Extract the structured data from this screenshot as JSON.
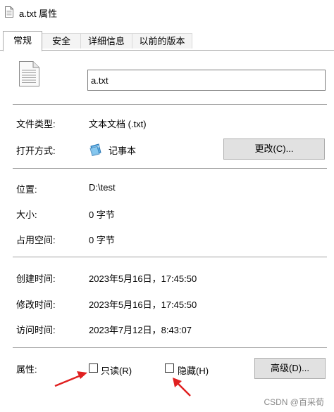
{
  "window": {
    "title": "a.txt 属性"
  },
  "tabs": [
    {
      "label": "常规",
      "active": true
    },
    {
      "label": "安全",
      "active": false
    },
    {
      "label": "详细信息",
      "active": false
    },
    {
      "label": "以前的版本",
      "active": false
    }
  ],
  "general": {
    "file_name": "a.txt",
    "file_type_label": "文件类型:",
    "file_type_value": "文本文档 (.txt)",
    "open_with_label": "打开方式:",
    "open_with_app": "记事本",
    "change_button": "更改(C)...",
    "location_label": "位置:",
    "location_value": "D:\\test",
    "size_label": "大小:",
    "size_value": "0 字节",
    "size_on_disk_label": "占用空间:",
    "size_on_disk_value": "0 字节",
    "created_label": "创建时间:",
    "created_value": "2023年5月16日，17:45:50",
    "modified_label": "修改时间:",
    "modified_value": "2023年5月16日，17:45:50",
    "accessed_label": "访问时间:",
    "accessed_value": "2023年7月12日，8:43:07",
    "attributes_label": "属性:",
    "readonly_label": "只读(R)",
    "hidden_label": "隐藏(H)",
    "advanced_button": "高级(D)..."
  },
  "annotation": {
    "arrow_color": "#e02020"
  },
  "watermark": "CSDN @百采荀"
}
